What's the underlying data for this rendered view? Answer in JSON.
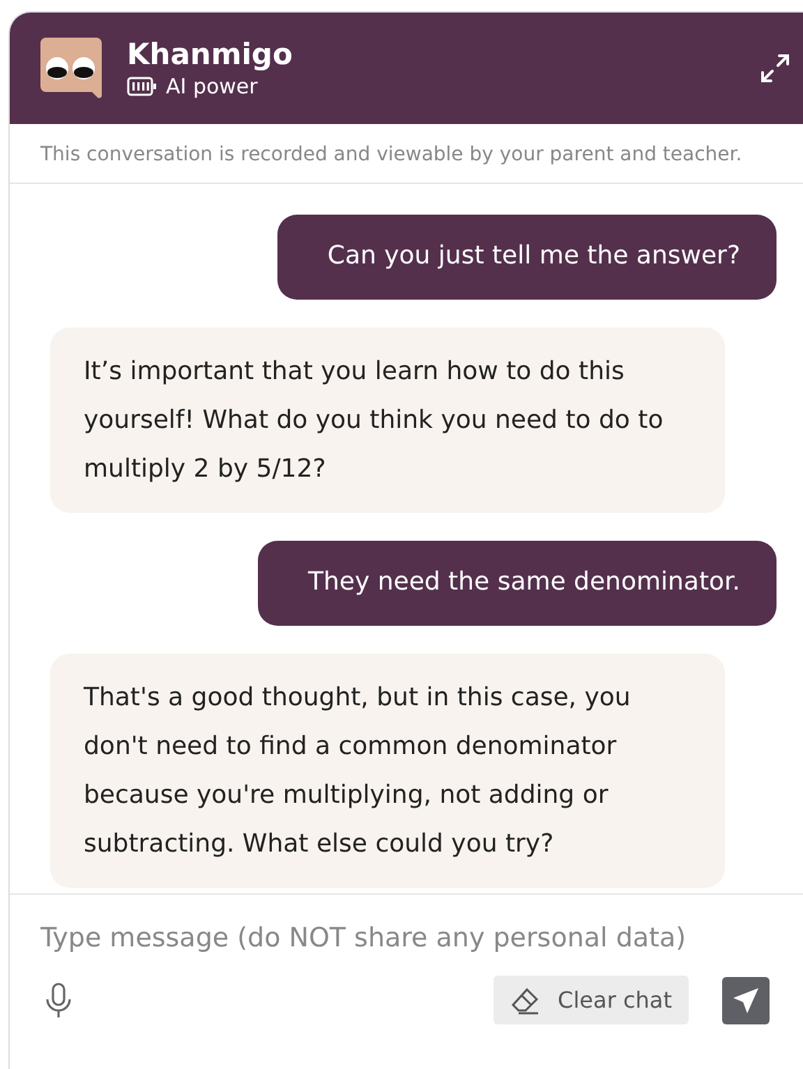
{
  "header": {
    "title": "Khanmigo",
    "subtitle": "AI power"
  },
  "notice": "This conversation is recorded and viewable by your parent and teacher.",
  "messages": [
    {
      "kind": "user",
      "text": "Can you just tell me the answer?"
    },
    {
      "kind": "bot",
      "text": "It’s important that you learn how to do this yourself! What do you think you need to do to multiply 2 by 5/12?"
    },
    {
      "kind": "user",
      "text": "They need the same denominator."
    },
    {
      "kind": "bot",
      "text": "That's a good thought, but in this case, you don't need to find a common denominator because you're multiplying, not adding or subtracting. What else could you try?"
    }
  ],
  "composer": {
    "placeholder": "Type message (do NOT share any personal data)",
    "clear_button": "Clear chat"
  }
}
